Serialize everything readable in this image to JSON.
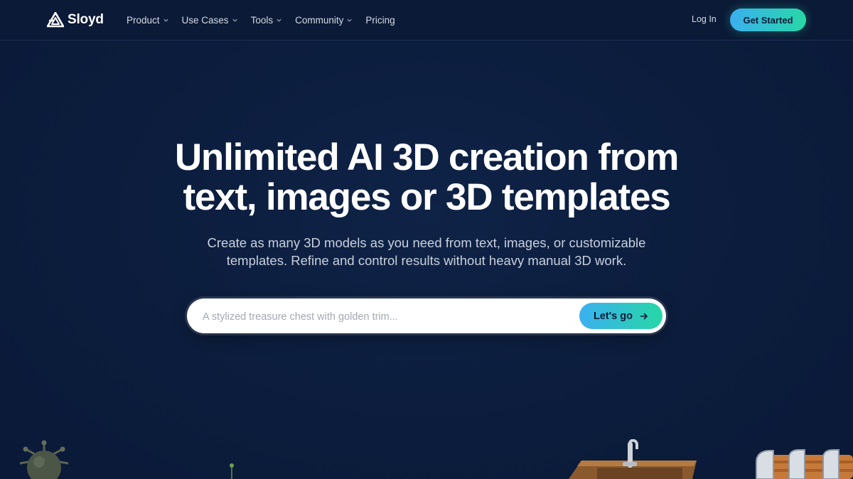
{
  "brand": {
    "name": "Sloyd",
    "logo_icon": "sloyd-logo-icon"
  },
  "nav": {
    "items": [
      {
        "label": "Product",
        "has_dropdown": true
      },
      {
        "label": "Use Cases",
        "has_dropdown": true
      },
      {
        "label": "Tools",
        "has_dropdown": true
      },
      {
        "label": "Community",
        "has_dropdown": true
      },
      {
        "label": "Pricing",
        "has_dropdown": false
      }
    ],
    "login_label": "Log In",
    "cta_label": "Get Started"
  },
  "hero": {
    "title_line1": "Unlimited AI 3D creation from",
    "title_line2": "text, images or 3D templates",
    "subtitle_line1": "Create as many 3D models as you need from text, images, or customizable",
    "subtitle_line2": "templates. Refine and control results without heavy manual 3D work."
  },
  "search": {
    "placeholder": "A stylized treasure chest with golden trim...",
    "value": "",
    "button_label": "Let's go",
    "button_icon": "arrow-right-icon"
  },
  "colors": {
    "background": "#0c1d3d",
    "nav_background": "#0b1a36",
    "accent_start": "#3bb0f0",
    "accent_end": "#27d7a6"
  }
}
